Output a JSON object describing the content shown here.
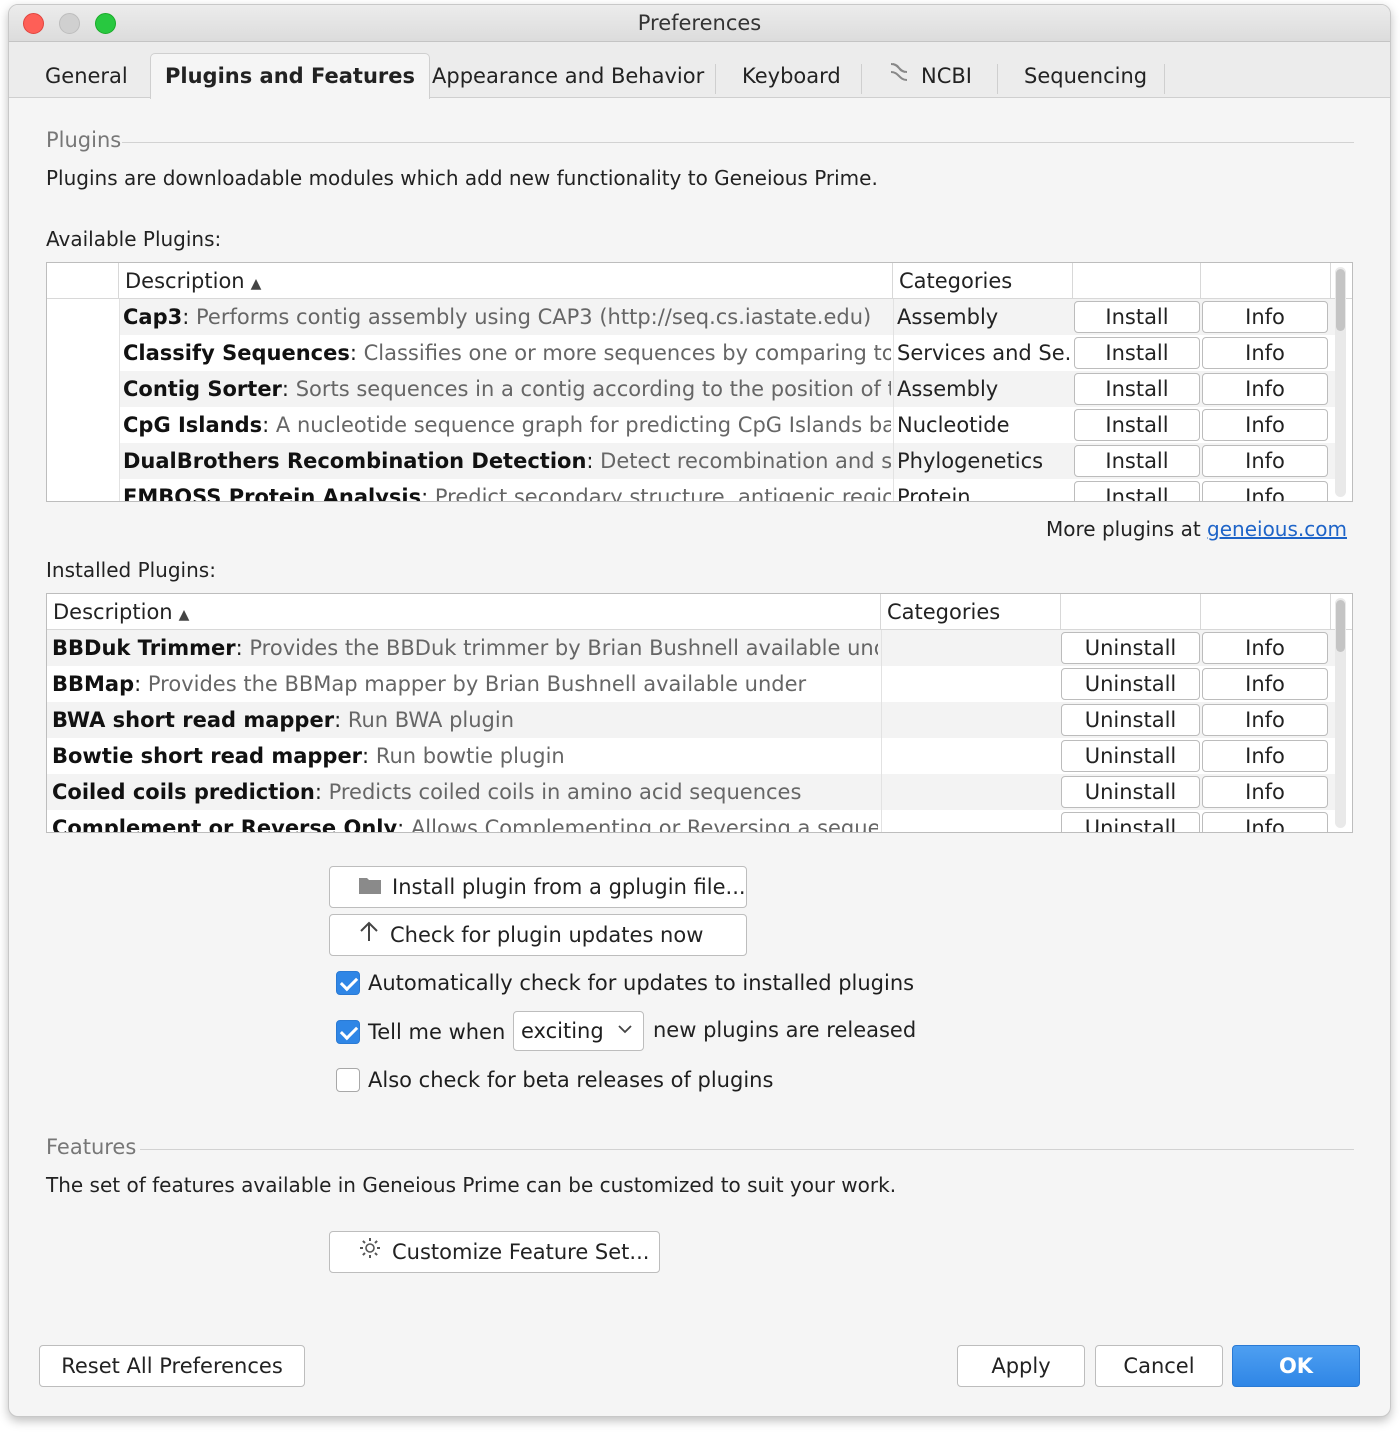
{
  "window": {
    "title": "Preferences"
  },
  "tabs": [
    {
      "label": "General"
    },
    {
      "label": "Plugins and Features"
    },
    {
      "label": "Appearance and Behavior"
    },
    {
      "label": "Keyboard"
    },
    {
      "label": "NCBI",
      "icon": "ncbi-helix-icon"
    },
    {
      "label": "Sequencing"
    }
  ],
  "plugins_section": {
    "title": "Plugins",
    "description": "Plugins are downloadable modules which add new functionality to Geneious Prime.",
    "available_label": "Available Plugins:",
    "installed_label": "Installed Plugins:",
    "more_text": "More plugins at ",
    "more_link": "geneious.com"
  },
  "available_table": {
    "headers": {
      "description": "Description",
      "categories": "Categories"
    },
    "sort_indicator": "▲",
    "rows": [
      {
        "name": "Cap3",
        "desc": "Performs contig assembly using CAP3 (http://seq.cs.iastate.edu)",
        "category": "Assembly",
        "action": "Install",
        "info": "Info"
      },
      {
        "name": "Classify Sequences",
        "desc": "Classifies one or more sequences by comparing to a",
        "category": "Services and Se...",
        "action": "Install",
        "info": "Info"
      },
      {
        "name": "Contig Sorter",
        "desc": "Sorts sequences in a contig according to the position of their",
        "category": "Assembly",
        "action": "Install",
        "info": "Info"
      },
      {
        "name": "CpG Islands",
        "desc": "A nucleotide sequence graph for predicting CpG Islands based",
        "category": "Nucleotide",
        "action": "Install",
        "info": "Info"
      },
      {
        "name": "DualBrothers Recombination Detection",
        "desc": "Detect recombination and spatial",
        "category": "Phylogenetics",
        "action": "Install",
        "info": "Info"
      },
      {
        "name": "EMBOSS Protein Analysis",
        "desc": "Predict secondary structure, antigenic regions",
        "category": "Protein",
        "action": "Install",
        "info": "Info"
      }
    ]
  },
  "installed_table": {
    "headers": {
      "description": "Description",
      "categories": "Categories"
    },
    "sort_indicator": "▲",
    "rows": [
      {
        "name": "BBDuk Trimmer",
        "desc": "Provides the BBDuk trimmer by Brian Bushnell available under",
        "category": "",
        "action": "Uninstall",
        "info": "Info"
      },
      {
        "name": "BBMap",
        "desc": "Provides the BBMap mapper by Brian Bushnell available under",
        "category": "",
        "action": "Uninstall",
        "info": "Info"
      },
      {
        "name": "BWA short read mapper",
        "desc": "Run BWA plugin",
        "category": "",
        "action": "Uninstall",
        "info": "Info"
      },
      {
        "name": "Bowtie short read mapper",
        "desc": "Run bowtie plugin",
        "category": "",
        "action": "Uninstall",
        "info": "Info"
      },
      {
        "name": "Coiled coils prediction",
        "desc": "Predicts coiled coils in amino acid sequences",
        "category": "",
        "action": "Uninstall",
        "info": "Info"
      },
      {
        "name": "Complement or Reverse Only",
        "desc": "Allows Complementing or Reversing a sequence",
        "category": "",
        "action": "Uninstall",
        "info": "Info"
      }
    ]
  },
  "plugin_actions": {
    "install_file": {
      "label": "Install plugin from a gplugin file...",
      "icon": "folder-icon"
    },
    "check_updates": {
      "label": "Check for plugin updates now",
      "icon": "arrow-up-icon"
    }
  },
  "options": {
    "auto_check": {
      "label": "Automatically check for updates to installed plugins",
      "checked": true
    },
    "tell_me": {
      "prefix": "Tell me when",
      "select_value": "exciting",
      "suffix": "new plugins are released",
      "checked": true
    },
    "beta": {
      "label": "Also check for beta releases of plugins",
      "checked": false
    }
  },
  "features_section": {
    "title": "Features",
    "description": "The set of features available in Geneious Prime can be customized to suit your work.",
    "customize_button": {
      "label": "Customize Feature Set...",
      "icon": "gear-icon"
    }
  },
  "footer": {
    "reset": "Reset All Preferences",
    "apply": "Apply",
    "cancel": "Cancel",
    "ok": "OK",
    "ok_color": "#2f86e6"
  }
}
